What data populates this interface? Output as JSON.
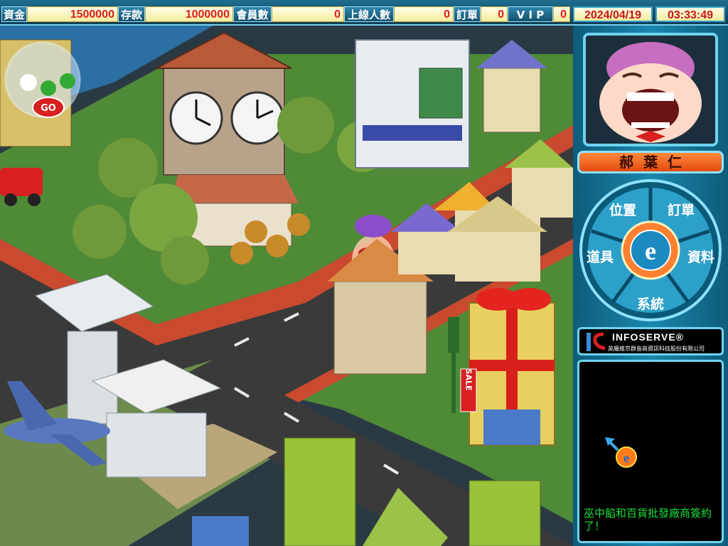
{
  "status": {
    "cash_label": "資金",
    "cash_value": "1500000",
    "deposit_label": "存款",
    "deposit_value": "1000000",
    "members_label": "會員數",
    "members_value": "0",
    "upline_label": "上線人數",
    "upline_value": "0",
    "orders_label": "訂單",
    "orders_value": "0",
    "vip_label": "V I P",
    "vip_value": "0",
    "date": "2024/04/19",
    "time": "03:33:49"
  },
  "scene": {
    "go_label": "GO",
    "sale_sign": "SALE"
  },
  "player": {
    "name": "郝葉仁"
  },
  "menu": {
    "position_label": "位置",
    "orders_label": "訂單",
    "data_label": "資料",
    "system_label": "系統",
    "items_label": "道具",
    "center_label": "e"
  },
  "sponsor": {
    "logo_text": "INFOSERVE®",
    "subtitle": "英屬維京群島商資訊科技股份有限公司"
  },
  "minimap": {
    "marker_label": "e",
    "message": "巫中餡和百貨批發廠商簽約了！"
  },
  "colors": {
    "panel_accent": "#6fd3f0",
    "value_text": "#d82020",
    "message_text": "#19e03a"
  }
}
